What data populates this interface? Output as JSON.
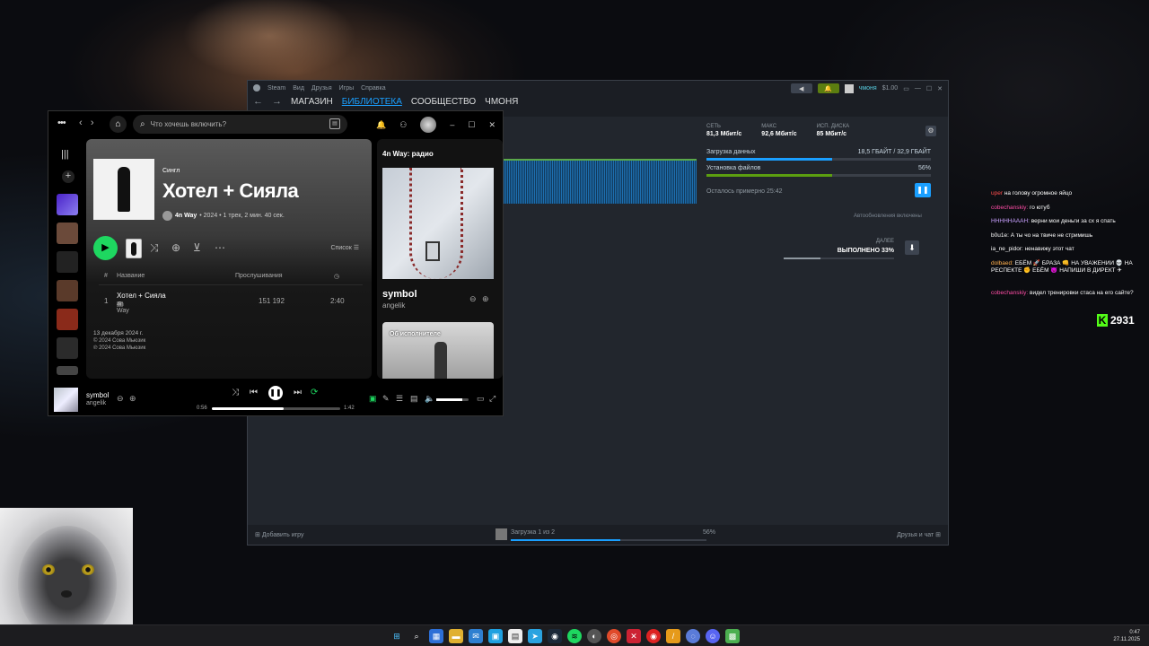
{
  "steam": {
    "menu": [
      "Steam",
      "Вид",
      "Друзья",
      "Игры",
      "Справка"
    ],
    "nav": [
      "МАГАЗИН",
      "БИБЛИОТЕКА",
      "СООБЩЕСТВО",
      "ЧМОНЯ"
    ],
    "user": "чмоня",
    "balance": "$1.00",
    "stats": [
      {
        "label": "СЕТЬ",
        "value": "81,3 Мбит/с"
      },
      {
        "label": "МАКС",
        "value": "92,6 Мбит/с"
      },
      {
        "label": "ИСП. ДИСКА",
        "value": "85 Мбит/с"
      }
    ],
    "download_label": "Загрузка данных",
    "download_value": "18,5 ГБАЙТ / 32,9 ГБАЙТ",
    "download_progress": 0.56,
    "install_label": "Установка файлов",
    "install_value": "56%",
    "install_progress": 0.56,
    "remaining": "Осталось примерно 25:42",
    "autoupdate": "Автообновления включены",
    "next_label": "ДАЛЕЕ",
    "next_status": "ВЫПОЛНЕНО 33%",
    "next_progress": 0.33,
    "add_game": "Добавить игру",
    "status_text": "Загрузка 1 из 2",
    "status_percent": "56%",
    "friends": "Друзья и чат"
  },
  "spotify": {
    "search_placeholder": "Что хочешь включить?",
    "type": "Сингл",
    "title": "Хотел + Сияла",
    "artist": "4n Way",
    "meta": "• 2024 • 1 трек, 2 мин. 40 сек.",
    "list_label": "Список",
    "col_num": "#",
    "col_title": "Название",
    "col_plays": "Прослушивания",
    "track": {
      "num": "1",
      "title": "Хотел + Сияла",
      "artist": "4n Way",
      "plays": "151 192",
      "duration": "2:40"
    },
    "release_date": "13 декабря 2024 г.",
    "copyright1": "© 2024 Сова Мьюзик",
    "copyright2": "℗ 2024 Сова Мьюзик",
    "radio": "4n Way: радио",
    "np_song": "symbol",
    "np_artist": "angelik",
    "about": "Об исполнителе",
    "time_current": "0:56",
    "time_total": "1:42",
    "seek_progress": 0.56,
    "volume_level": 0.8
  },
  "chat": [
    {
      "user": "uper",
      "color": "#ff4d4d",
      "text": "на голову огромное яйцо"
    },
    {
      "user": "cobechanskiy:",
      "color": "#ff4da6",
      "text": "го ютуб"
    },
    {
      "user": "HHHHHAAAH:",
      "color": "#c9a0ff",
      "text": "верни мои деньги за сх я спать"
    },
    {
      "user": "b0u1e:",
      "color": "#ffffff",
      "text": "А ты чо на твиче не стримишь"
    },
    {
      "user": "ia_ne_pidor:",
      "color": "#ffffff",
      "text": "ненавижу этот чат"
    },
    {
      "user": "dolbaed:",
      "color": "#ffb04d",
      "text": "ЕБЁМ 🚀 БРАЗА 👊 НА УВАЖЕНИИ 💀 НА РЕСПЕКТЕ ✊ ЕБЁМ 😈 НАПИШИ В ДИРЕКТ ✈"
    },
    {
      "user": "cobechanskiy:",
      "color": "#ff4da6",
      "text": "видел тренировки стаса на его сайте?"
    }
  ],
  "kick_count": "2931",
  "clock": {
    "time": "0:47",
    "date": "27.11.2025"
  }
}
